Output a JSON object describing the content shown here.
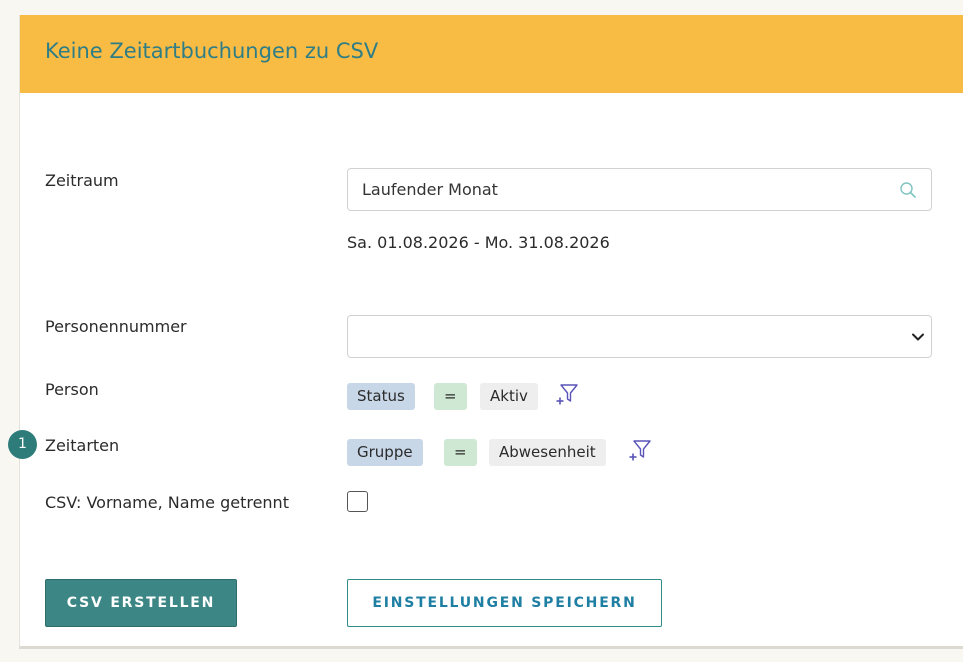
{
  "header": {
    "title": "Keine Zeitartbuchungen zu CSV"
  },
  "form": {
    "zeitraum": {
      "label": "Zeitraum",
      "value": "Laufender Monat",
      "range": "Sa. 01.08.2026 - Mo. 31.08.2026"
    },
    "personennummer": {
      "label": "Personennummer",
      "value": ""
    },
    "person": {
      "label": "Person",
      "filter": {
        "field": "Status",
        "operator": "=",
        "value": "Aktiv"
      }
    },
    "zeitarten": {
      "label": "Zeitarten",
      "step": "1",
      "filter": {
        "field": "Gruppe",
        "operator": "=",
        "value": "Abwesenheit"
      }
    },
    "csv_split": {
      "label": "CSV: Vorname, Name getrennt",
      "checked": false
    }
  },
  "actions": {
    "create_csv": "CSV ERSTELLEN",
    "save_settings": "EINSTELLUNGEN SPEICHERN"
  },
  "colors": {
    "header_bg": "#f8bb43",
    "title": "#2f7e86",
    "primary_button": "#3c8785",
    "secondary_button_text": "#1f7fa3",
    "step_badge": "#2e7c7a",
    "chip_field": "#c8d7e8",
    "chip_operator": "#cfe8d3",
    "chip_value": "#eeeeee",
    "filter_icon": "#5a54b8"
  }
}
